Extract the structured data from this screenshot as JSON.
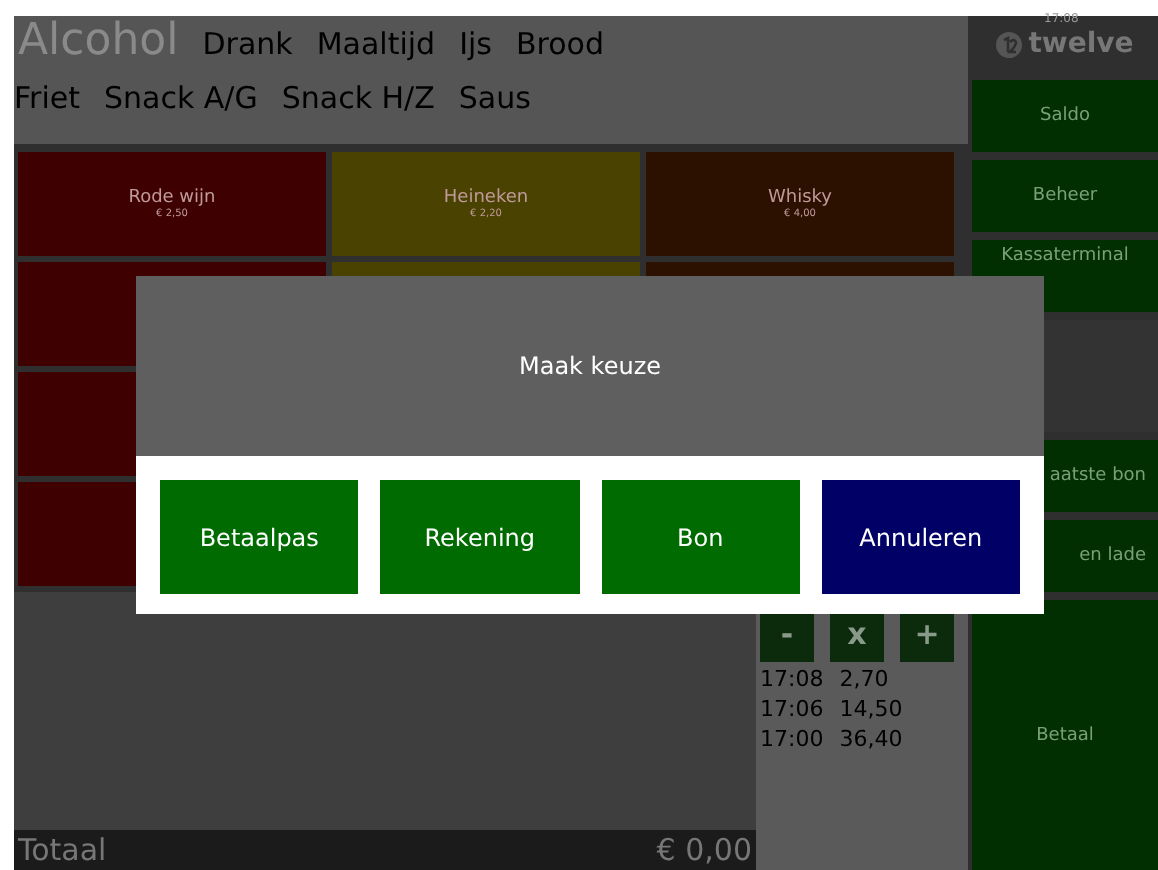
{
  "categories": [
    [
      {
        "label": "Alcohol",
        "selected": true
      },
      {
        "label": "Drank",
        "selected": false
      },
      {
        "label": "Maaltijd",
        "selected": false
      },
      {
        "label": "Ijs",
        "selected": false
      },
      {
        "label": "Brood",
        "selected": false
      }
    ],
    [
      {
        "label": "Friet",
        "selected": false
      },
      {
        "label": "Snack A/G",
        "selected": false
      },
      {
        "label": "Snack H/Z",
        "selected": false
      },
      {
        "label": "Saus",
        "selected": false
      }
    ]
  ],
  "products": [
    [
      {
        "name": "Rode wijn",
        "price": "€ 2,50",
        "color": "#3e0000"
      },
      {
        "name": "Heineken",
        "price": "€ 2,20",
        "color": "#4a4200"
      },
      {
        "name": "Whisky",
        "price": "€ 4,00",
        "color": "#2c1000"
      }
    ],
    [
      {
        "color": "#3e0000"
      },
      {
        "color": "#4a4200"
      },
      {
        "color": "#2c1000"
      }
    ],
    [
      {
        "color": "#3e0000"
      }
    ],
    [
      {
        "color": "#3e0000"
      }
    ]
  ],
  "order": {
    "total_label": "Totaal",
    "total": "€ 0,00"
  },
  "quantity_buttons": [
    "-",
    "x",
    "+"
  ],
  "history": [
    {
      "time": "17:08",
      "amount": "2,70"
    },
    {
      "time": "17:06",
      "amount": "14,50"
    },
    {
      "time": "17:00",
      "amount": "36,40"
    }
  ],
  "logo": {
    "time": "17:08",
    "name": "twelve"
  },
  "side_buttons": [
    {
      "label": "Saldo",
      "kind": "button"
    },
    {
      "label": "Beheer",
      "kind": "button"
    },
    {
      "label": "Kassaterminal",
      "kind": "button"
    },
    {
      "kind": "blank"
    },
    {
      "label": "aatste bon",
      "kind": "button"
    },
    {
      "label": "en lade",
      "kind": "button"
    },
    {
      "label": "Betaal",
      "kind": "large"
    }
  ],
  "dialog": {
    "title": "Maak keuze",
    "buttons": [
      {
        "label": "Betaalpas",
        "kind": "confirm"
      },
      {
        "label": "Rekening",
        "kind": "confirm"
      },
      {
        "label": "Bon",
        "kind": "confirm"
      },
      {
        "label": "Annuleren",
        "kind": "cancel"
      }
    ]
  }
}
